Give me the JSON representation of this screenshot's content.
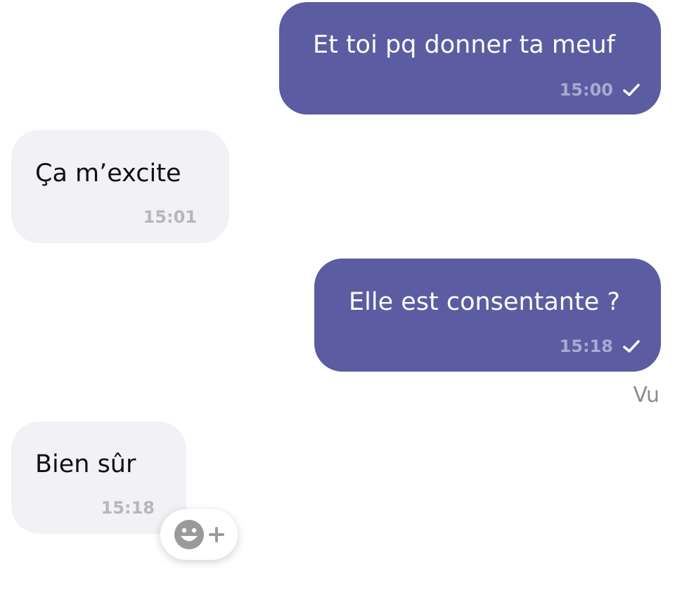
{
  "messages": [
    {
      "direction": "outgoing",
      "text": "Et toi pq donner ta meuf",
      "time": "15:00",
      "status_icon": "check-icon"
    },
    {
      "direction": "incoming",
      "text": "Ça m’excite",
      "time": "15:01"
    },
    {
      "direction": "outgoing",
      "text": "Elle est consentante ?",
      "time": "15:18",
      "status_icon": "check-icon"
    },
    {
      "direction": "incoming",
      "text": "Bien sûr",
      "time": "15:18"
    }
  ],
  "seen_label": "Vu",
  "reaction_button": {
    "icons": [
      "smiley-icon",
      "plus-icon"
    ]
  },
  "colors": {
    "outgoing_bubble": "#5b5ca1",
    "incoming_bubble": "#f1f1f6",
    "outgoing_time": "#a9aad3",
    "incoming_time": "#b6b6bd",
    "seen_text": "#8c8c8c"
  }
}
